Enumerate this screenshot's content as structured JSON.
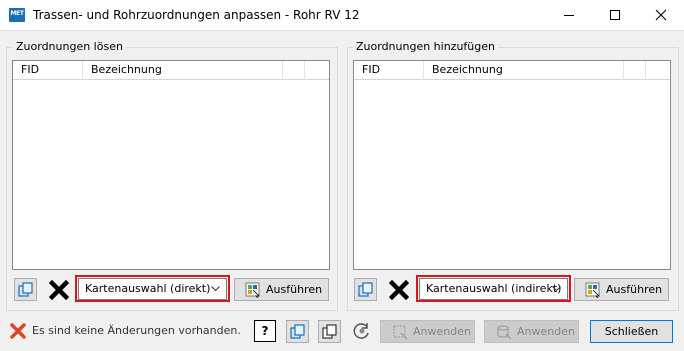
{
  "window": {
    "title": "Trassen- und Rohrzuordnungen anpassen - Rohr RV 12",
    "app_icon_text": "MET",
    "controls": [
      "minimize",
      "maximize",
      "close"
    ]
  },
  "left_panel": {
    "group_label": "Zuordnungen lösen",
    "columns": [
      "FID",
      "Bezeichnung"
    ],
    "rows": [],
    "selection_mode": "Kartenauswahl (direkt)",
    "execute_label": "Ausführen",
    "icons": [
      "copy-icon",
      "delete-x-icon",
      "execute-icon"
    ]
  },
  "right_panel": {
    "group_label": "Zuordnungen hinzufügen",
    "columns": [
      "FID",
      "Bezeichnung"
    ],
    "rows": [],
    "selection_mode": "Kartenauswahl (indirekt)",
    "execute_label": "Ausführen",
    "icons": [
      "copy-icon",
      "delete-x-icon",
      "execute-icon"
    ]
  },
  "footer": {
    "status_text": "Es sind keine Änderungen vorhanden.",
    "help_label": "?",
    "apply_label_1": "Anwenden",
    "apply_label_2": "Anwenden",
    "close_label": "Schließen"
  },
  "colors": {
    "highlight_border": "#d7171f",
    "window_bg": "#f0f0f0",
    "grid_border": "#828790",
    "icon_blue": "#1c6fb5"
  }
}
